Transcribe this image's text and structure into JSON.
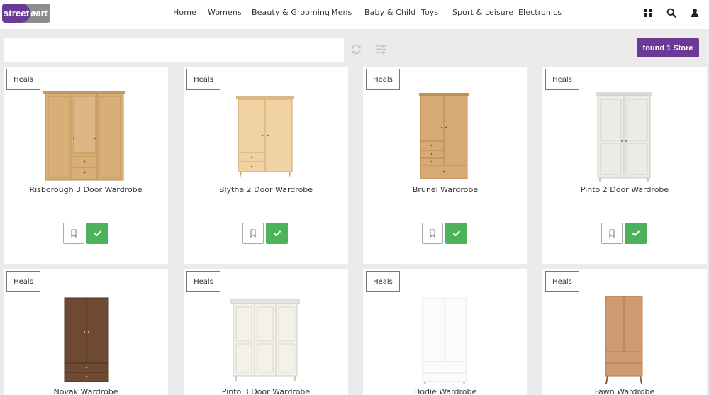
{
  "brand": {
    "left": "street",
    "right": "cart"
  },
  "nav": {
    "items": [
      {
        "label": "Home"
      },
      {
        "label": "Womens"
      },
      {
        "label": "Beauty & Grooming"
      },
      {
        "label": "Mens"
      },
      {
        "label": "Baby & Child"
      },
      {
        "label": "Toys"
      },
      {
        "label": "Sport & Leisure"
      },
      {
        "label": "Electronics"
      }
    ]
  },
  "header_icons": [
    "grid-icon",
    "search-icon",
    "user-icon"
  ],
  "search": {
    "value": "",
    "placeholder": ""
  },
  "toolbar": {
    "refresh_icon": "refresh-icon",
    "filter_icon": "sliders-icon",
    "found_label": "found 1 Store"
  },
  "colors": {
    "brand_purple": "#6b3a96",
    "brand_grey": "#8d8d8d",
    "accent_green": "#4cb35a"
  },
  "products": [
    {
      "store": "Heals",
      "title": "Risborough 3 Door Wardrobe",
      "finish": "oak"
    },
    {
      "store": "Heals",
      "title": "Blythe 2 Door Wardrobe",
      "finish": "light-oak"
    },
    {
      "store": "Heals",
      "title": "Brunel Wardrobe",
      "finish": "oak"
    },
    {
      "store": "Heals",
      "title": "Pinto 2 Door Wardrobe",
      "finish": "grey"
    },
    {
      "store": "Heals",
      "title": "Novak Wardrobe",
      "finish": "walnut"
    },
    {
      "store": "Heals",
      "title": "Pinto 3 Door Wardrobe",
      "finish": "white"
    },
    {
      "store": "Heals",
      "title": "Dodie Wardrobe",
      "finish": "gloss-white"
    },
    {
      "store": "Heals",
      "title": "Fawn Wardrobe",
      "finish": "light-wood"
    }
  ]
}
